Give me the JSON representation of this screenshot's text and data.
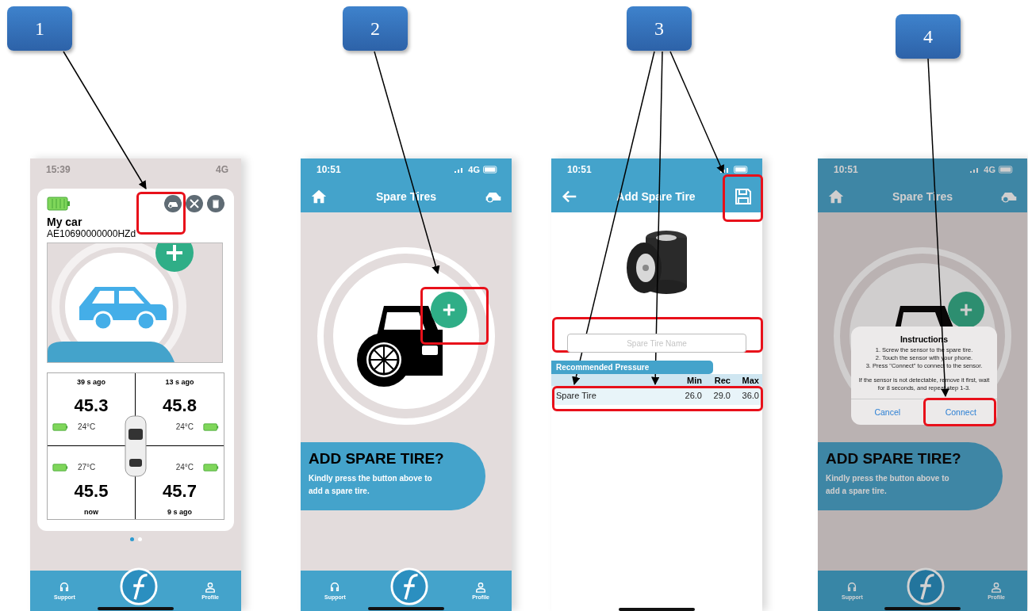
{
  "steps": [
    {
      "number": "1"
    },
    {
      "number": "2"
    },
    {
      "number": "3"
    },
    {
      "number": "4"
    }
  ],
  "screens": [
    {
      "kind": "dashboard",
      "status_time": "15:39",
      "network": "4G",
      "car_name": "My car",
      "car_id": "AE10690000000HZd",
      "tires": [
        {
          "updated": "39 s ago",
          "pressure": "45.3",
          "temperature": "24°C"
        },
        {
          "updated": "13 s ago",
          "pressure": "45.8",
          "temperature": "24°C"
        },
        {
          "updated": "now",
          "pressure": "45.5",
          "temperature": "27°C"
        },
        {
          "updated": "9 s ago",
          "pressure": "45.7",
          "temperature": "24°C"
        }
      ],
      "pager": [
        {
          "selected": true
        },
        {
          "selected": false
        }
      ],
      "nav": [
        {
          "label": "Support"
        },
        {
          "label": "Profile"
        }
      ]
    },
    {
      "kind": "spare_list",
      "status_time": "10:51",
      "network": "4G",
      "title": "Spare Tires",
      "heading": "ADD SPARE TIRE?",
      "message": "Kindly press the button above to add a spare tire.",
      "nav": [
        {
          "label": "Support"
        },
        {
          "label": "Profile"
        }
      ]
    },
    {
      "kind": "add_spare",
      "status_time": "10:51",
      "title": "Add Spare Tire",
      "placeholder": "Spare Tire Name",
      "section": "Recommended Pressure",
      "columns": [
        "Min",
        "Rec",
        "Max"
      ],
      "rows": [
        {
          "name": "Spare Tire",
          "values": [
            "26.0",
            "29.0",
            "36.0"
          ]
        }
      ]
    },
    {
      "kind": "spare_dialog",
      "status_time": "10:51",
      "network": "4G",
      "title": "Spare Tires",
      "heading": "ADD SPARE TIRE?",
      "message": "Kindly press the button above to add a spare tire.",
      "dialog": {
        "title": "Instructions",
        "lines": [
          "1. Screw the sensor to the spare tire.",
          "2. Touch the sensor with your phone.",
          "3. Press \"Connect\" to connect to the sensor."
        ],
        "note": "If the sensor is not detectable, remove it first, wait for 8 seconds, and repeat step 1-3.",
        "buttons": [
          "Cancel",
          "Connect"
        ]
      },
      "nav": [
        {
          "label": "Support"
        },
        {
          "label": "Profile"
        }
      ]
    }
  ]
}
